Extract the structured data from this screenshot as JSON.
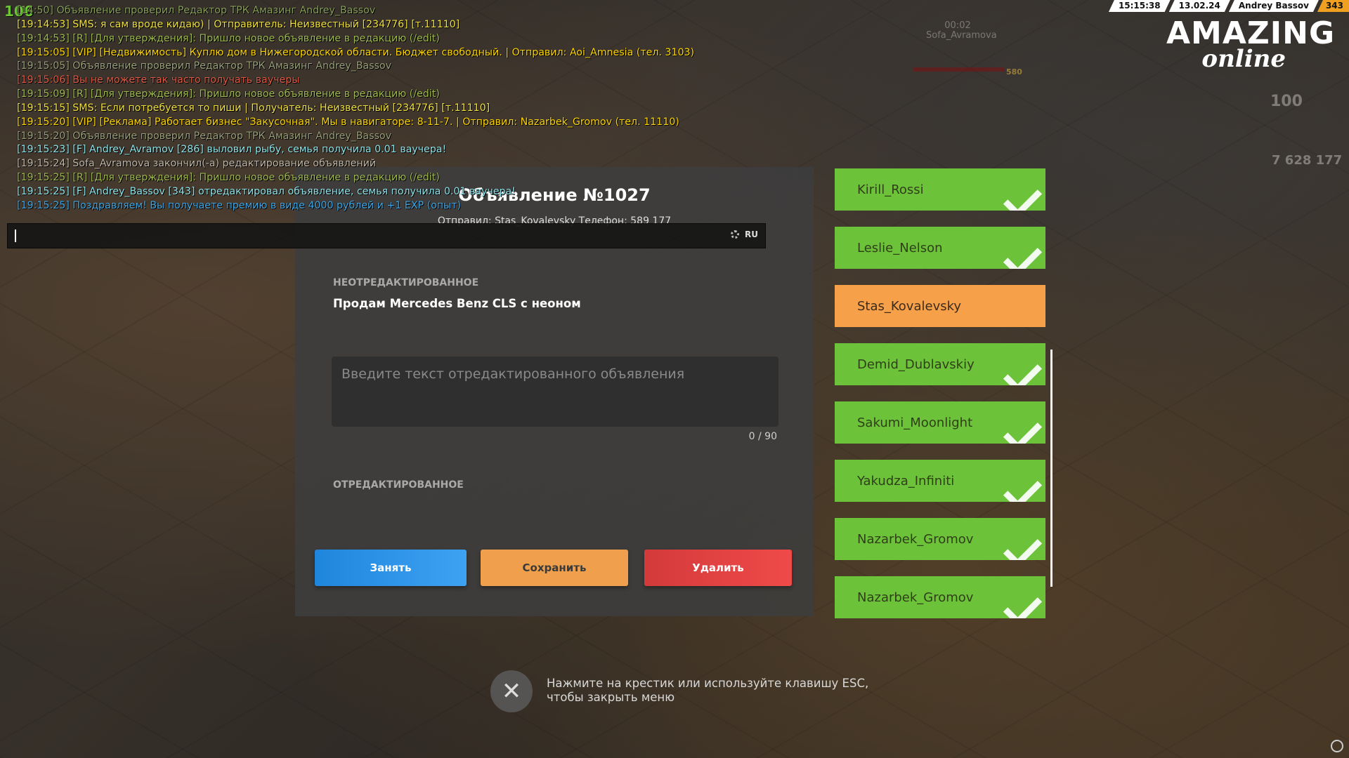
{
  "hud": {
    "fps": "106",
    "time": "15:15:38",
    "date": "13.02.24",
    "player": "Andrey Bassov",
    "player_id": "343"
  },
  "logo": {
    "main": "AMAZING",
    "sub": "online"
  },
  "background": {
    "nearby_player_timer": "00:02",
    "nearby_player_name": "Sofa_Avramova",
    "nearby_value": "580",
    "stat_hp": "100",
    "money": "7 628 177"
  },
  "chat": [
    {
      "text": "[14:50] Объявление проверил Редактор ТРК Амазинг Andrey_Bassov",
      "type": "top"
    },
    {
      "text": "[19:14:53] SMS: я сам вроде кидаю) | Отправитель: Неизвестный [234776] [т.11110]",
      "type": "sms"
    },
    {
      "text": "[19:14:53] [R] [Для утверждения]: Пришло новое объявление в редакцию (/edit)",
      "type": "r"
    },
    {
      "text": "[19:15:05] [VIP] [Недвижимость] Куплю дом в Нижегородской области. Бюджет свободный. | Отправил: Aoi_Amnesia (тел. 3103)",
      "type": "vip"
    },
    {
      "text": "[19:15:05] Объявление проверил Редактор ТРК Амазинг Andrey_Bassov",
      "type": "edit"
    },
    {
      "text": "[19:15:06] Вы не можете так часто получать ваучеры",
      "type": "err"
    },
    {
      "text": "[19:15:09] [R] [Для утверждения]: Пришло новое объявление в редакцию (/edit)",
      "type": "r"
    },
    {
      "text": "[19:15:15] SMS: Если потребуется то пиши | Получатель: Неизвестный [234776] [т.11110]",
      "type": "sms"
    },
    {
      "text": "[19:15:20] [VIP] [Реклама] Работает бизнес \"Закусочная\". Мы в навигаторе: 8-11-7. | Отправил: Nazarbek_Gromov (тел. 11110)",
      "type": "vip"
    },
    {
      "text": "[19:15:20] Объявление проверил Редактор ТРК Амазинг Andrey_Bassov",
      "type": "edit"
    },
    {
      "text": "[19:15:23] [F] Andrey_Avramov [286] выловил рыбу, семья получила 0.01 ваучера!",
      "type": "fam"
    },
    {
      "text": "[19:15:24] Sofa_Avramova закончил(-а) редактирование объявлений",
      "type": "sofa"
    },
    {
      "text": "[19:15:25] [R] [Для утверждения]: Пришло новое объявление в редакцию (/edit)",
      "type": "r"
    },
    {
      "text": "[19:15:25] [F] Andrey_Bassov [343] отредактировал объявление, семья получила 0.01 ваучера!",
      "type": "fam"
    },
    {
      "text": "[19:15:25] Поздравляем! Вы получаете премию в виде 4000 рублей и +1 EXP (опыт)",
      "type": "bonus"
    }
  ],
  "chat_input": {
    "lang": "RU",
    "settings_icon": "gear-icon"
  },
  "panel": {
    "title": "Объявление №1027",
    "sender": "Отправил: Stas_Kovalevsky Телефон: 589 177",
    "unedited_label": "НЕОТРЕДАКТИРОВАННОЕ",
    "unedited_text": "Продам Mercedes Benz CLS с неоном",
    "input_placeholder": "Введите текст отредактированного объявления",
    "counter": "0 / 90",
    "edited_label": "ОТРЕДАКТИРОВАННОЕ",
    "btn_take": "Занять",
    "btn_save": "Сохранить",
    "btn_delete": "Удалить"
  },
  "queue": [
    {
      "name": "Kirill_Rossi",
      "status": "done"
    },
    {
      "name": "Leslie_Nelson",
      "status": "done"
    },
    {
      "name": "Stas_Kovalevsky",
      "status": "active"
    },
    {
      "name": "Demid_Dublavskiy",
      "status": "done"
    },
    {
      "name": "Sakumi_Moonlight",
      "status": "done"
    },
    {
      "name": "Yakudza_Infiniti",
      "status": "done"
    },
    {
      "name": "Nazarbek_Gromov",
      "status": "done"
    },
    {
      "name": "Nazarbek_Gromov",
      "status": "done"
    }
  ],
  "close_hint": "Нажмите на крестик или используйте клавишу ESC, чтобы закрыть меню",
  "colors": {
    "done": "#6cc33a",
    "active": "#f6a04a",
    "take": "#2a94e8",
    "save": "#f0a04c",
    "delete": "#e04242"
  }
}
